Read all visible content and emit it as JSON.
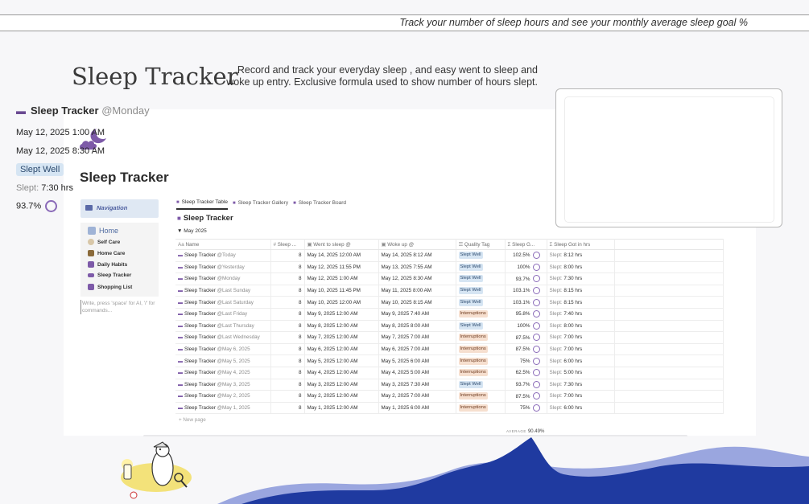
{
  "banner": {
    "text": "Track your number of sleep hours and see your monthly average sleep goal  %"
  },
  "hero": {
    "title": "Sleep Tracker",
    "description": "Record and track your everyday sleep , and easy went to sleep and woke up entry. Exclusive formula used to show number of hours slept."
  },
  "page": {
    "title": "Sleep Tracker",
    "icon": "moon-cloud-icon"
  },
  "nav": {
    "header": "Navigation",
    "home": "Home",
    "items": [
      {
        "label": "Self Care",
        "icon": "hand-icon",
        "color": "#c9b089"
      },
      {
        "label": "Home Care",
        "icon": "house-plant-icon",
        "color": "#7a5a2a"
      },
      {
        "label": "Daily Habits",
        "icon": "list-icon",
        "color": "#6a4a92"
      },
      {
        "label": "Sleep Tracker",
        "icon": "bed-icon",
        "color": "#6a4a92"
      },
      {
        "label": "Shopping List",
        "icon": "cart-icon",
        "color": "#6a4a92"
      }
    ],
    "placeholder": "Write, press 'space' for AI, '/' for commands..."
  },
  "tabs": [
    {
      "label": "Sleep Tracker Table",
      "active": true
    },
    {
      "label": "Sleep Tracker Gallery",
      "active": false
    },
    {
      "label": "Sleep Tracker Board",
      "active": false
    }
  ],
  "database": {
    "title": "Sleep Tracker",
    "group": "May 2025"
  },
  "columns": {
    "name": "Name",
    "sleep": "Sleep ...",
    "went": "Went to sleep @",
    "woke": "Woke up @",
    "quality": "Quality Tag",
    "goal": "Sleep G...",
    "hrs": "Sleep Got in hrs"
  },
  "rows": [
    {
      "name": "Sleep Tracker",
      "sub": "@Today",
      "sleep": "8",
      "went": "May 14, 2025 12:00 AM",
      "woke": "May 14, 2025 8:12 AM",
      "tag": "Slept Well",
      "tag_type": "well",
      "goal": "102.5%",
      "hrs_label": "Slept:",
      "hrs": "8:12 hrs"
    },
    {
      "name": "Sleep Tracker",
      "sub": "@Yesterday",
      "sleep": "8",
      "went": "May 12, 2025 11:55 PM",
      "woke": "May 13, 2025 7:55 AM",
      "tag": "Slept Well",
      "tag_type": "well",
      "goal": "100%",
      "hrs_label": "Slept:",
      "hrs": "8:00 hrs"
    },
    {
      "name": "Sleep Tracker",
      "sub": "@Monday",
      "sleep": "8",
      "went": "May 12, 2025 1:00 AM",
      "woke": "May 12, 2025 8:30 AM",
      "tag": "Slept Well",
      "tag_type": "well",
      "goal": "93.7%",
      "hrs_label": "Slept:",
      "hrs": "7:30 hrs"
    },
    {
      "name": "Sleep Tracker",
      "sub": "@Last Sunday",
      "sleep": "8",
      "went": "May 10, 2025 11:45 PM",
      "woke": "May 11, 2025 8:00 AM",
      "tag": "Slept Well",
      "tag_type": "well",
      "goal": "103.1%",
      "hrs_label": "Slept:",
      "hrs": "8:15 hrs"
    },
    {
      "name": "Sleep Tracker",
      "sub": "@Last Saturday",
      "sleep": "8",
      "went": "May 10, 2025 12:00 AM",
      "woke": "May 10, 2025 8:15 AM",
      "tag": "Slept Well",
      "tag_type": "well",
      "goal": "103.1%",
      "hrs_label": "Slept:",
      "hrs": "8:15 hrs"
    },
    {
      "name": "Sleep Tracker",
      "sub": "@Last Friday",
      "sleep": "8",
      "went": "May 9, 2025 12:00 AM",
      "woke": "May 9, 2025 7:40 AM",
      "tag": "Interruptions",
      "tag_type": "intr",
      "goal": "95.8%",
      "hrs_label": "Slept:",
      "hrs": "7:40 hrs"
    },
    {
      "name": "Sleep Tracker",
      "sub": "@Last Thursday",
      "sleep": "8",
      "went": "May 8, 2025 12:00 AM",
      "woke": "May 8, 2025 8:00 AM",
      "tag": "Slept Well",
      "tag_type": "well",
      "goal": "100%",
      "hrs_label": "Slept:",
      "hrs": "8:00 hrs"
    },
    {
      "name": "Sleep Tracker",
      "sub": "@Last Wednesday",
      "sleep": "8",
      "went": "May 7, 2025 12:00 AM",
      "woke": "May 7, 2025 7:00 AM",
      "tag": "Interruptions",
      "tag_type": "intr",
      "goal": "87.5%",
      "hrs_label": "Slept:",
      "hrs": "7:00 hrs"
    },
    {
      "name": "Sleep Tracker",
      "sub": "@May 6, 2025",
      "sleep": "8",
      "went": "May 6, 2025 12:00 AM",
      "woke": "May 6, 2025 7:00 AM",
      "tag": "Interruptions",
      "tag_type": "intr",
      "goal": "87.5%",
      "hrs_label": "Slept:",
      "hrs": "7:00 hrs"
    },
    {
      "name": "Sleep Tracker",
      "sub": "@May 5, 2025",
      "sleep": "8",
      "went": "May 5, 2025 12:00 AM",
      "woke": "May 5, 2025 6:00 AM",
      "tag": "Interruptions",
      "tag_type": "intr",
      "goal": "75%",
      "hrs_label": "Slept:",
      "hrs": "6:00 hrs"
    },
    {
      "name": "Sleep Tracker",
      "sub": "@May 4, 2025",
      "sleep": "8",
      "went": "May 4, 2025 12:00 AM",
      "woke": "May 4, 2025 5:00 AM",
      "tag": "Interruptions",
      "tag_type": "intr",
      "goal": "62.5%",
      "hrs_label": "Slept:",
      "hrs": "5:00 hrs"
    },
    {
      "name": "Sleep Tracker",
      "sub": "@May 3, 2025",
      "sleep": "8",
      "went": "May 3, 2025 12:00 AM",
      "woke": "May 3, 2025 7:30 AM",
      "tag": "Slept Well",
      "tag_type": "well",
      "goal": "93.7%",
      "hrs_label": "Slept:",
      "hrs": "7:30 hrs"
    },
    {
      "name": "Sleep Tracker",
      "sub": "@May 2, 2025",
      "sleep": "8",
      "went": "May 2, 2025 12:00 AM",
      "woke": "May 2, 2025 7:00 AM",
      "tag": "Interruptions",
      "tag_type": "intr",
      "goal": "87.5%",
      "hrs_label": "Slept:",
      "hrs": "7:00 hrs"
    },
    {
      "name": "Sleep Tracker",
      "sub": "@May 1, 2025",
      "sleep": "8",
      "went": "May 1, 2025 12:00 AM",
      "woke": "May 1, 2025 6:00 AM",
      "tag": "Interruptions",
      "tag_type": "intr",
      "goal": "75%",
      "hrs_label": "Slept:",
      "hrs": "6:00 hrs"
    }
  ],
  "footer": {
    "new_page": "+ New page",
    "avg_label": "AVERAGE",
    "avg_value": "90.49%"
  },
  "popup": {
    "title": "Sleep Tracker",
    "sub": "@Monday",
    "went": "May 12, 2025 1:00 AM",
    "woke": "May 12, 2025 8:30 AM",
    "tag": "Slept Well",
    "hrs_label": "Slept:",
    "hrs": "7:30 hrs",
    "goal": "93.7%"
  },
  "colors": {
    "accent": "#7d5aa8",
    "wave_dark": "#1f3aa0",
    "wave_light": "#8a9ad8"
  }
}
